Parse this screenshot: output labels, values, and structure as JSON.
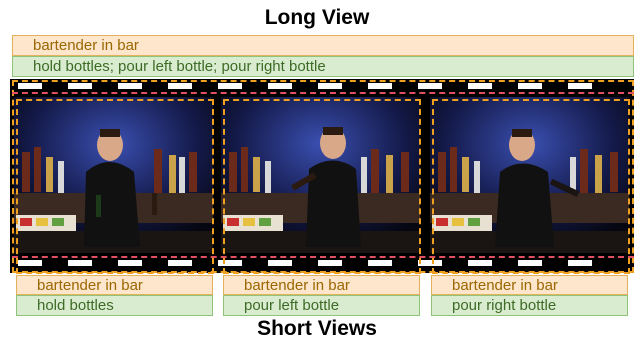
{
  "top_title": "Long View",
  "bottom_title": "Short Views",
  "long_view": {
    "caption": "bartender in bar",
    "actions": "hold bottles; pour left bottle; pour right bottle"
  },
  "short_views": [
    {
      "caption": "bartender in bar",
      "action": "hold bottles"
    },
    {
      "caption": "bartender in bar",
      "action": "pour left bottle"
    },
    {
      "caption": "bartender in bar",
      "action": "pour right bottle"
    }
  ],
  "colors": {
    "caption_fill": "#fde6cc",
    "action_fill": "#d9ecd0",
    "dash_orange": "#f0a020",
    "dash_red": "#e05060"
  }
}
